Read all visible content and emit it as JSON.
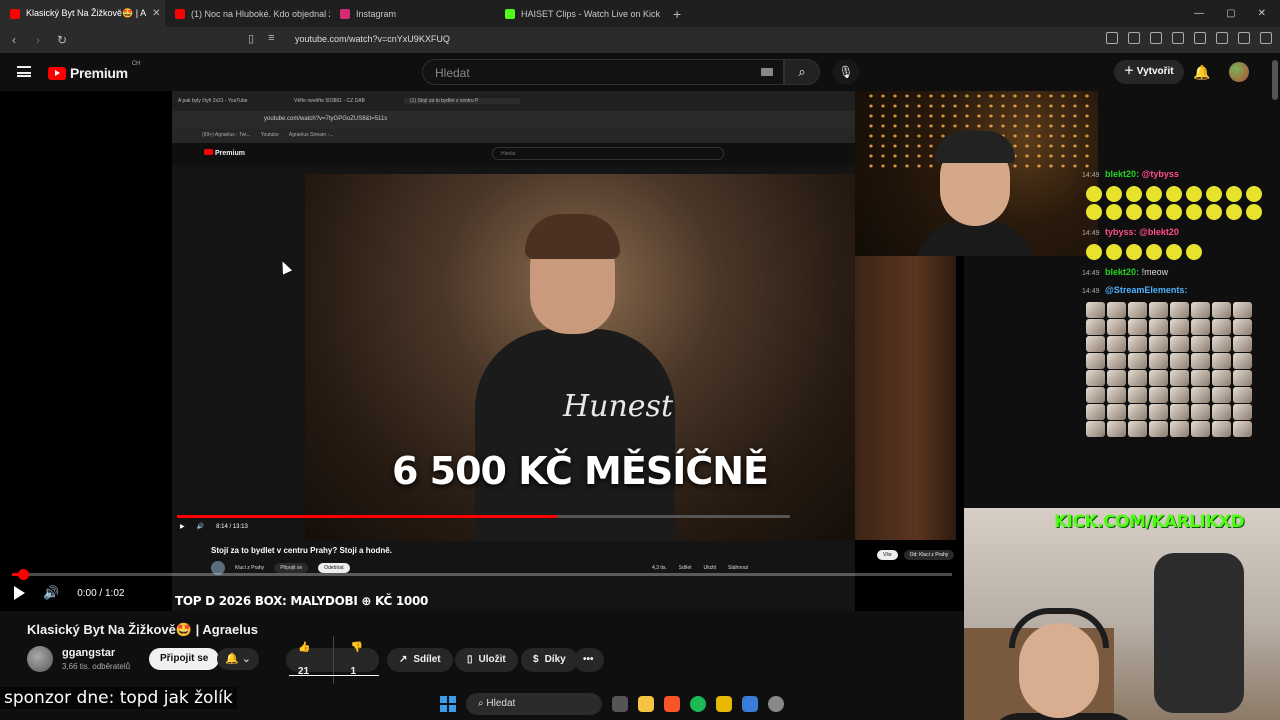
{
  "browser": {
    "tabs": [
      {
        "label": "Klasický Byt Na Žižkově🤩 | A",
        "active": true,
        "color": "#ff0000"
      },
      {
        "label": "(1) Noc na Hluboké. Kdo objednal ži",
        "active": false,
        "color": "#ff0000"
      },
      {
        "label": "Instagram",
        "active": false,
        "color": "#d62976"
      },
      {
        "label": "HAISET Clips - Watch Live on Kick",
        "active": false,
        "color": "#53fc18"
      }
    ],
    "url": "youtube.com/watch?v=cnYxU9KXFUQ"
  },
  "header": {
    "logo_text": "Premium",
    "logo_region": "CH",
    "search_placeholder": "Hledat",
    "create_label": "Vytvořit"
  },
  "inner_browser": {
    "tabs": [
      "A pak byly čtyři 2x21 - YouTube",
      "Věřte nevěřte 503801 - CZ DAB",
      "(1) Stojí za to bydlet v centru P"
    ],
    "url": "youtube.com/watch?v=7tyGPGoZUS8&t=511s",
    "bookmarks": [
      "(99+) Agraelus - Twi...",
      "Youtube",
      "Agraelus Stream -..."
    ],
    "logo_text": "Premium",
    "search_placeholder": "Hledat",
    "overlay_text": "6 500 KČ MĚSÍČNĚ",
    "hoodie_text": "Hunest",
    "time": "8:14 / 13:13",
    "progress": 0.62,
    "title": "Stojí za to bydlet v centru Prahy? Stojí a hodně.",
    "channel": "Kluci z Prahy",
    "join": "Připojit se",
    "subscribe": "Odebírat",
    "likes": "4,3 tis.",
    "share": "Sdílet",
    "save": "Uložit",
    "download": "Stáhnout",
    "chips": [
      "Vše",
      "Od: Kluci z Prahy"
    ]
  },
  "player": {
    "time": "0:00 / 1:02",
    "progress": 0.01,
    "ticker": "TOP D 2026 BOX: MALYDOBI ⊕ KČ 1000"
  },
  "video": {
    "title": "Klasický Byt Na Žižkově🤩 | Agraelus",
    "channel_name": "ggangstar",
    "subscribers": "3,66 tis. odběratelů",
    "join_label": "Připojit se",
    "likes": "21",
    "dislikes": "1",
    "share_label": "Sdílet",
    "save_label": "Uložit",
    "thanks_label": "Díky"
  },
  "overlay": {
    "sponsor": "sponzor dne: topd jak žolík",
    "kick_brand": "KICK.COM/KARLIKXD"
  },
  "chat": [
    {
      "time": "14:49",
      "user": "blekt20:",
      "mention": "@tybyss"
    },
    {
      "time": "14:49",
      "user": "tybyss:",
      "mention": "@blekt20"
    },
    {
      "time": "14:49",
      "user": "blekt20:",
      "message": "!meow"
    },
    {
      "time": "14:49",
      "user": "@StreamElements:"
    }
  ],
  "taskbar": {
    "search_placeholder": "Hledat"
  }
}
